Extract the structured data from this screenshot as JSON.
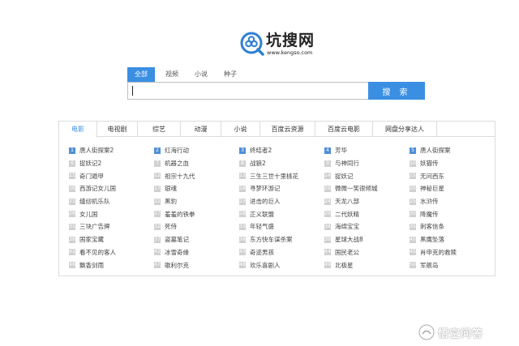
{
  "logo": {
    "title": "坑搜网",
    "domain": "www.kengso.com",
    "accent_color": "#2f7fd1"
  },
  "search": {
    "tabs": [
      {
        "label": "全部",
        "active": true
      },
      {
        "label": "视频",
        "active": false
      },
      {
        "label": "小说",
        "active": false
      },
      {
        "label": "种子",
        "active": false
      }
    ],
    "input_value": "",
    "button_label": "搜 索",
    "accent_color": "#3b8fe3"
  },
  "rank": {
    "tabs": [
      {
        "label": "电影",
        "active": true
      },
      {
        "label": "电视剧",
        "active": false
      },
      {
        "label": "综艺",
        "active": false
      },
      {
        "label": "动漫",
        "active": false
      },
      {
        "label": "小说",
        "active": false
      },
      {
        "label": "百度云资源",
        "active": false
      },
      {
        "label": "百度云电影",
        "active": false
      },
      {
        "label": "网盘分享达人",
        "active": false
      }
    ],
    "columns": [
      [
        {
          "num": "1",
          "title": "唐人街探案2"
        },
        {
          "num": "6",
          "title": "捉妖记2"
        },
        {
          "num": "11",
          "title": "奇门遁甲"
        },
        {
          "num": "16",
          "title": "西游记女儿国"
        },
        {
          "num": "21",
          "title": "缝纫机乐队"
        },
        {
          "num": "26",
          "title": "女儿国"
        },
        {
          "num": "31",
          "title": "三块广告牌"
        },
        {
          "num": "36",
          "title": "国家宝藏"
        },
        {
          "num": "41",
          "title": "看不见的客人"
        },
        {
          "num": "46",
          "title": "飘香剑雨"
        }
      ],
      [
        {
          "num": "2",
          "title": "红海行动"
        },
        {
          "num": "7",
          "title": "机器之血"
        },
        {
          "num": "12",
          "title": "祖宗十九代"
        },
        {
          "num": "17",
          "title": "银魂"
        },
        {
          "num": "22",
          "title": "黑豹"
        },
        {
          "num": "27",
          "title": "羞羞的铁拳"
        },
        {
          "num": "32",
          "title": "死侍"
        },
        {
          "num": "37",
          "title": "盗墓笔记"
        },
        {
          "num": "42",
          "title": "冰雪奇缘"
        },
        {
          "num": "47",
          "title": "歌利尔克"
        }
      ],
      [
        {
          "num": "3",
          "title": "终结者2"
        },
        {
          "num": "8",
          "title": "战狼2"
        },
        {
          "num": "13",
          "title": "三生三世十里桃花"
        },
        {
          "num": "18",
          "title": "寻梦环游记"
        },
        {
          "num": "23",
          "title": "进击的巨人"
        },
        {
          "num": "28",
          "title": "正义联盟"
        },
        {
          "num": "33",
          "title": "年轻气盛"
        },
        {
          "num": "38",
          "title": "东方快车谋杀案"
        },
        {
          "num": "43",
          "title": "奇迹男孩"
        },
        {
          "num": "48",
          "title": "欢乐喜剧人"
        }
      ],
      [
        {
          "num": "4",
          "title": "芳华"
        },
        {
          "num": "9",
          "title": "与神同行"
        },
        {
          "num": "14",
          "title": "捉妖记"
        },
        {
          "num": "19",
          "title": "微微一笑很倾城"
        },
        {
          "num": "24",
          "title": "天龙八部"
        },
        {
          "num": "29",
          "title": "二代妖精"
        },
        {
          "num": "34",
          "title": "海绵宝宝"
        },
        {
          "num": "39",
          "title": "星球大战8"
        },
        {
          "num": "44",
          "title": "国民老公"
        },
        {
          "num": "49",
          "title": "北极星"
        }
      ],
      [
        {
          "num": "5",
          "title": "唐人街探案"
        },
        {
          "num": "10",
          "title": "妖猫传"
        },
        {
          "num": "15",
          "title": "无问西东"
        },
        {
          "num": "20",
          "title": "神秘巨星"
        },
        {
          "num": "25",
          "title": "水浒传"
        },
        {
          "num": "30",
          "title": "降魔传"
        },
        {
          "num": "35",
          "title": "刺客信条"
        },
        {
          "num": "40",
          "title": "黑鹰坠落"
        },
        {
          "num": "45",
          "title": "肖申克的救赎"
        },
        {
          "num": "50",
          "title": "军舰岛"
        }
      ]
    ],
    "top_badge_color": "#4f8fd6",
    "badge_color": "#d0d0d0"
  },
  "watermark": {
    "text": "悟空问答"
  }
}
